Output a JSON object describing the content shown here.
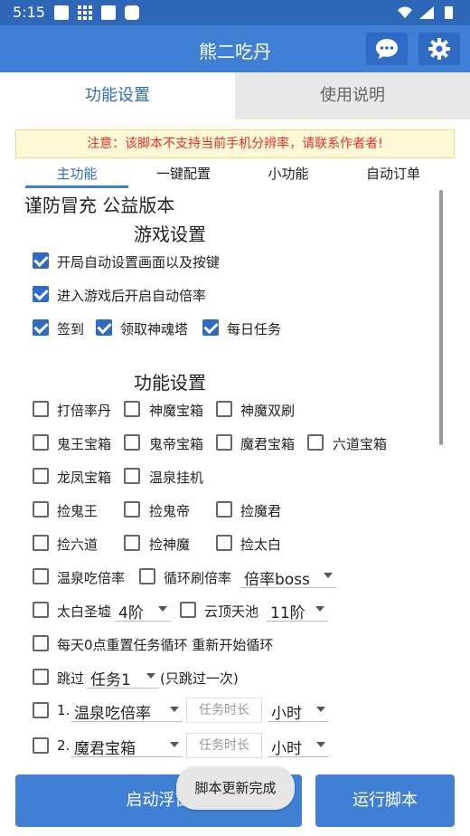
{
  "status_bar": {
    "time": "5:15"
  },
  "app_bar": {
    "title": "熊二吃丹"
  },
  "tabs": [
    "功能设置",
    "使用说明"
  ],
  "notice": "注意：该脚本不支持当前手机分辨率，请联系作者者!",
  "sub_tabs": [
    "主功能",
    "一键配置",
    "小功能",
    "自动订单"
  ],
  "heading_main": "谨防冒充 公益版本",
  "game_settings": {
    "title": "游戏设置",
    "auto_setup": {
      "label": "开局自动设置画面以及按键",
      "checked": true
    },
    "auto_rate": {
      "label": "进入游戏后开启自动倍率",
      "checked": true
    },
    "sign_in": {
      "label": "签到",
      "checked": true
    },
    "tower": {
      "label": "领取神魂塔",
      "checked": true
    },
    "daily": {
      "label": "每日任务",
      "checked": true
    }
  },
  "function_settings": {
    "title": "功能设置",
    "r1": [
      "打倍率丹",
      "神魔宝箱",
      "神魔双刷"
    ],
    "r2": [
      "鬼王宝箱",
      "鬼帝宝箱",
      "魔君宝箱",
      "六道宝箱"
    ],
    "r3": [
      "龙凤宝箱",
      "温泉挂机"
    ],
    "r4": [
      "捡鬼王",
      "捡鬼帝",
      "捡魔君"
    ],
    "r5": [
      "捡六道",
      "捡神魔",
      "捡太白"
    ],
    "hot_spring_rate": "温泉吃倍率",
    "loop_rate": "循环刷倍率",
    "loop_select": "倍率boss",
    "taibai": "太白圣墟",
    "taibai_select": "4阶",
    "cloud": "云顶天池",
    "cloud_select": "11阶",
    "reset_loop": "每天0点重置任务循环 重新开始循环",
    "skip": "跳过",
    "skip_select": "任务1",
    "skip_note": "(只跳过一次)",
    "task_rows": [
      {
        "num": "1.",
        "task": "温泉吃倍率",
        "placeholder": "任务时长",
        "unit": "小时"
      },
      {
        "num": "2.",
        "task": "魔君宝箱",
        "placeholder": "任务时长",
        "unit": "小时"
      }
    ]
  },
  "buttons": {
    "float": "启动浮窗",
    "run": "运行脚本"
  },
  "toast": "脚本更新完成",
  "colors": {
    "primary": "#3f7fd4",
    "status_bar": "#2f67b8",
    "notice_text": "#e0322b"
  }
}
